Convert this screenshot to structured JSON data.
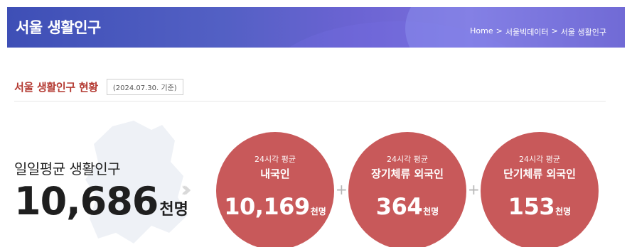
{
  "header": {
    "title": "서울 생활인구",
    "breadcrumb": [
      "Home",
      ">",
      "서울빅데이터",
      ">",
      "서울 생활인구"
    ]
  },
  "section": {
    "title": "서울 생활인구 현황",
    "date": "(2024.07.30. 기준)"
  },
  "summary": {
    "label": "일일평균 생활인구",
    "value": "10,686",
    "unit": "천명"
  },
  "circles": [
    {
      "sub": "24시각 평균",
      "name": "내국인",
      "value": "10,169",
      "unit": "천명"
    },
    {
      "sub": "24시각 평균",
      "name": "장기체류 외국인",
      "value": "364",
      "unit": "천명"
    },
    {
      "sub": "24시각 평균",
      "name": "단기체류 외국인",
      "value": "153",
      "unit": "천명"
    }
  ],
  "operators": [
    "+",
    "+"
  ],
  "colors": {
    "accent": "#b43a32",
    "circle": "#c8595a",
    "header_start": "#3e4fb6",
    "header_end": "#7b6fdc"
  },
  "icons": {
    "chevrons": "double-chevron-right-icon",
    "map": "seoul-map-icon"
  }
}
